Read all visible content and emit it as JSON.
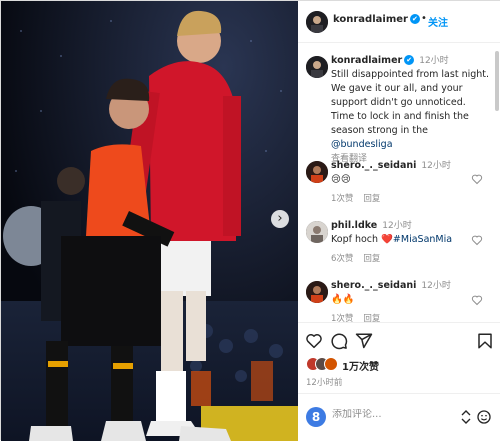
{
  "header": {
    "username": "konradlaimer",
    "verified_mark": "✔",
    "separator": "•",
    "follow_label": "关注"
  },
  "caption": {
    "username": "konradlaimer",
    "time": "12小时",
    "text": "Still disappointed from last night. We gave it our all, and your support didn't go unnoticed. Time to lock in and finish the season strong in the",
    "mention": "@bundesliga",
    "translate_label": "查看翻译"
  },
  "comments": [
    {
      "username": "shero._._seidani",
      "time": "12小时",
      "text_emoji": [
        "😢",
        "😢"
      ],
      "likes": "1次赞",
      "reply": "回复"
    },
    {
      "username": "phil.ldke",
      "time": "12小时",
      "text": "Kopf hoch",
      "heart": "❤️",
      "hashtag": "#MiaSanMia",
      "likes": "6次赞",
      "reply": "回复"
    },
    {
      "username": "shero._._seidani",
      "time": "12小时",
      "text_emoji": [
        "🔥",
        "🔥"
      ],
      "likes": "1次赞",
      "reply": "回复"
    }
  ],
  "actions": {
    "icons": [
      "heart-icon",
      "comment-icon",
      "share-icon",
      "bookmark-icon"
    ],
    "likes_label": "1万次赞",
    "post_time": "12小时前"
  },
  "add_comment": {
    "placeholder": "添加评论...",
    "emoji_badge": "8"
  },
  "colors": {
    "accent": "#0095f6",
    "link": "#00376b",
    "muted": "#8e8e8e",
    "jersey_red": "#d0162a"
  }
}
